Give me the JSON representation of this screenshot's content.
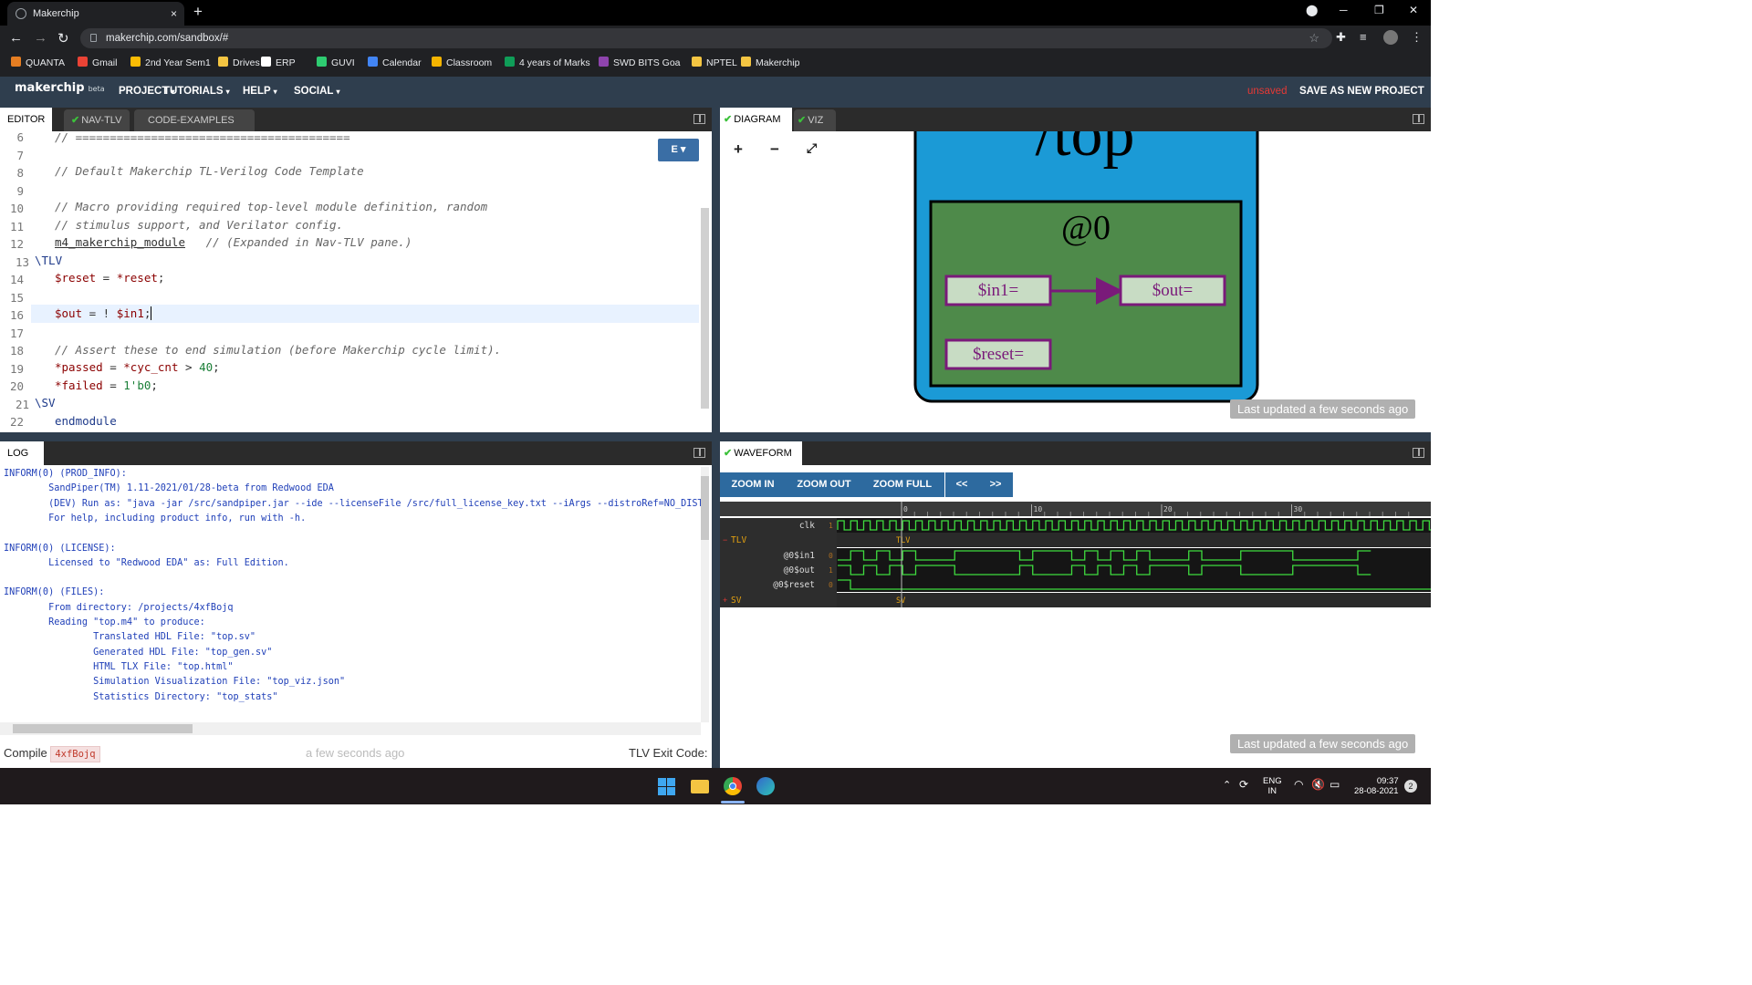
{
  "browser": {
    "tab_title": "Makerchip",
    "tab_close": "×",
    "new_tab": "+",
    "url": "makerchip.com/sandbox/#",
    "bookmarks": [
      {
        "label": "QUANTA",
        "color": "#e67e22"
      },
      {
        "label": "Gmail",
        "color": "#ea4335"
      },
      {
        "label": "2nd Year Sem1",
        "color": "#fbbc04"
      },
      {
        "label": "Drives",
        "color": "#f4c542"
      },
      {
        "label": "ERP",
        "color": "#ffffff"
      },
      {
        "label": "GUVI",
        "color": "#2ecc71"
      },
      {
        "label": "Calendar",
        "color": "#4285f4"
      },
      {
        "label": "Classroom",
        "color": "#f4b400"
      },
      {
        "label": "4 years of Marks",
        "color": "#0f9d58"
      },
      {
        "label": "SWD BITS Goa",
        "color": "#8e44ad"
      },
      {
        "label": "NPTEL",
        "color": "#f4c542"
      },
      {
        "label": "Makerchip",
        "color": "#f4c542"
      }
    ]
  },
  "app": {
    "logo": "makerchip",
    "logo_sub": "beta",
    "menus": [
      "PROJECT",
      "TUTORIALS",
      "HELP",
      "SOCIAL"
    ],
    "unsaved": "unsaved",
    "save_as": "SAVE AS NEW PROJECT"
  },
  "editor_tabs": {
    "editor": "EDITOR",
    "navtlv": "NAV-TLV",
    "examples": "CODE-EXAMPLES",
    "examples_close": "✖"
  },
  "editor": {
    "mode_button": "E ▾",
    "line_numbers": [
      "6",
      "7",
      "8",
      "9",
      "10",
      "11",
      "12",
      "13",
      "14",
      "15",
      "16",
      "17",
      "18",
      "19",
      "20",
      "21",
      "22"
    ],
    "lines": {
      "l6": "// ========================================",
      "l8": "// Default Makerchip TL-Verilog Code Template",
      "l10": "// Macro providing required top-level module definition, random",
      "l11": "// stimulus support, and Verilator config.",
      "l12a": "m4_makerchip_module",
      "l12b": "   // (Expanded in Nav-TLV pane.)",
      "l13": "\\TLV",
      "l14a": "$reset",
      "l14b": " = ",
      "l14c": "*reset",
      "l14d": ";",
      "l16a": "$out",
      "l16b": " = ! ",
      "l16c": "$in1",
      "l16d": ";",
      "l18": "// Assert these to end simulation (before Makerchip cycle limit).",
      "l19a": "*passed",
      "l19b": " = ",
      "l19c": "*cyc_cnt",
      "l19d": " > ",
      "l19e": "40",
      "l19f": ";",
      "l20a": "*failed",
      "l20b": " = ",
      "l20c": "1'b0",
      "l20d": ";",
      "l21": "\\SV",
      "l22": "endmodule"
    }
  },
  "log": {
    "tab": "LOG",
    "lines": [
      "INFORM(0) (PROD_INFO):",
      "        SandPiper(TM) 1.11-2021/01/28-beta from Redwood EDA",
      "        (DEV) Run as: \"java -jar /src/sandpiper.jar --ide --licenseFile /src/full_license_key.txt --iArgs --distroRef=NO_DIST",
      "        For help, including product info, run with -h.",
      "",
      "INFORM(0) (LICENSE):",
      "        Licensed to \"Redwood EDA\" as: Full Edition.",
      "",
      "INFORM(0) (FILES):",
      "        From directory: /projects/4xfBojq",
      "        Reading \"top.m4\" to produce:",
      "                Translated HDL File: \"top.sv\"",
      "                Generated HDL File: \"top_gen.sv\"",
      "                HTML TLX File: \"top.html\"",
      "                Simulation Visualization File: \"top_viz.json\"",
      "                Statistics Directory: \"top_stats\""
    ],
    "compile_label": "Compile",
    "compile_id": "4xfBojq",
    "time": "a few seconds ago",
    "exit_label": "TLV Exit Code:"
  },
  "diagram": {
    "tab": "DIAGRAM",
    "viz_tab": "VIZ",
    "zoom_in": "+",
    "zoom_out": "−",
    "fit": "⤢",
    "top_label": "/top",
    "stage_label": "@0",
    "in1": "$in1=",
    "out": "$out=",
    "reset": "$reset=",
    "updated": "Last updated a few seconds ago"
  },
  "waveform": {
    "tab": "WAVEFORM",
    "zoom_in": "ZOOM IN",
    "zoom_out": "ZOOM OUT",
    "zoom_full": "ZOOM FULL",
    "prev": "<<",
    "next": ">>",
    "ticks": [
      "0",
      "10",
      "20",
      "30"
    ],
    "signals": [
      "clk",
      "TLV",
      "@0$in1",
      "@0$out",
      "@0$reset",
      "SV"
    ],
    "values": [
      "1",
      "0",
      "1",
      "0"
    ],
    "in1_steps": [
      0,
      1,
      0,
      1,
      0,
      1,
      0,
      0,
      0,
      1,
      1,
      1,
      1,
      1,
      0,
      1,
      1,
      1,
      0,
      1,
      0,
      1,
      0,
      1,
      0,
      0,
      0,
      1,
      0,
      0,
      0,
      1,
      1,
      1,
      1,
      0,
      0,
      0,
      0,
      0,
      1
    ],
    "updated": "Last updated a few seconds ago"
  },
  "taskbar": {
    "lang1": "ENG",
    "lang2": "IN",
    "time": "09:37",
    "date": "28-08-2021",
    "notif": "2"
  },
  "colors": {
    "accent": "#2d6a9f",
    "diagram_blue": "#1b9ad6",
    "diagram_green": "#4e8a4a",
    "signal_purple": "#7a1a7a",
    "wave_green": "#3fdc3f"
  }
}
